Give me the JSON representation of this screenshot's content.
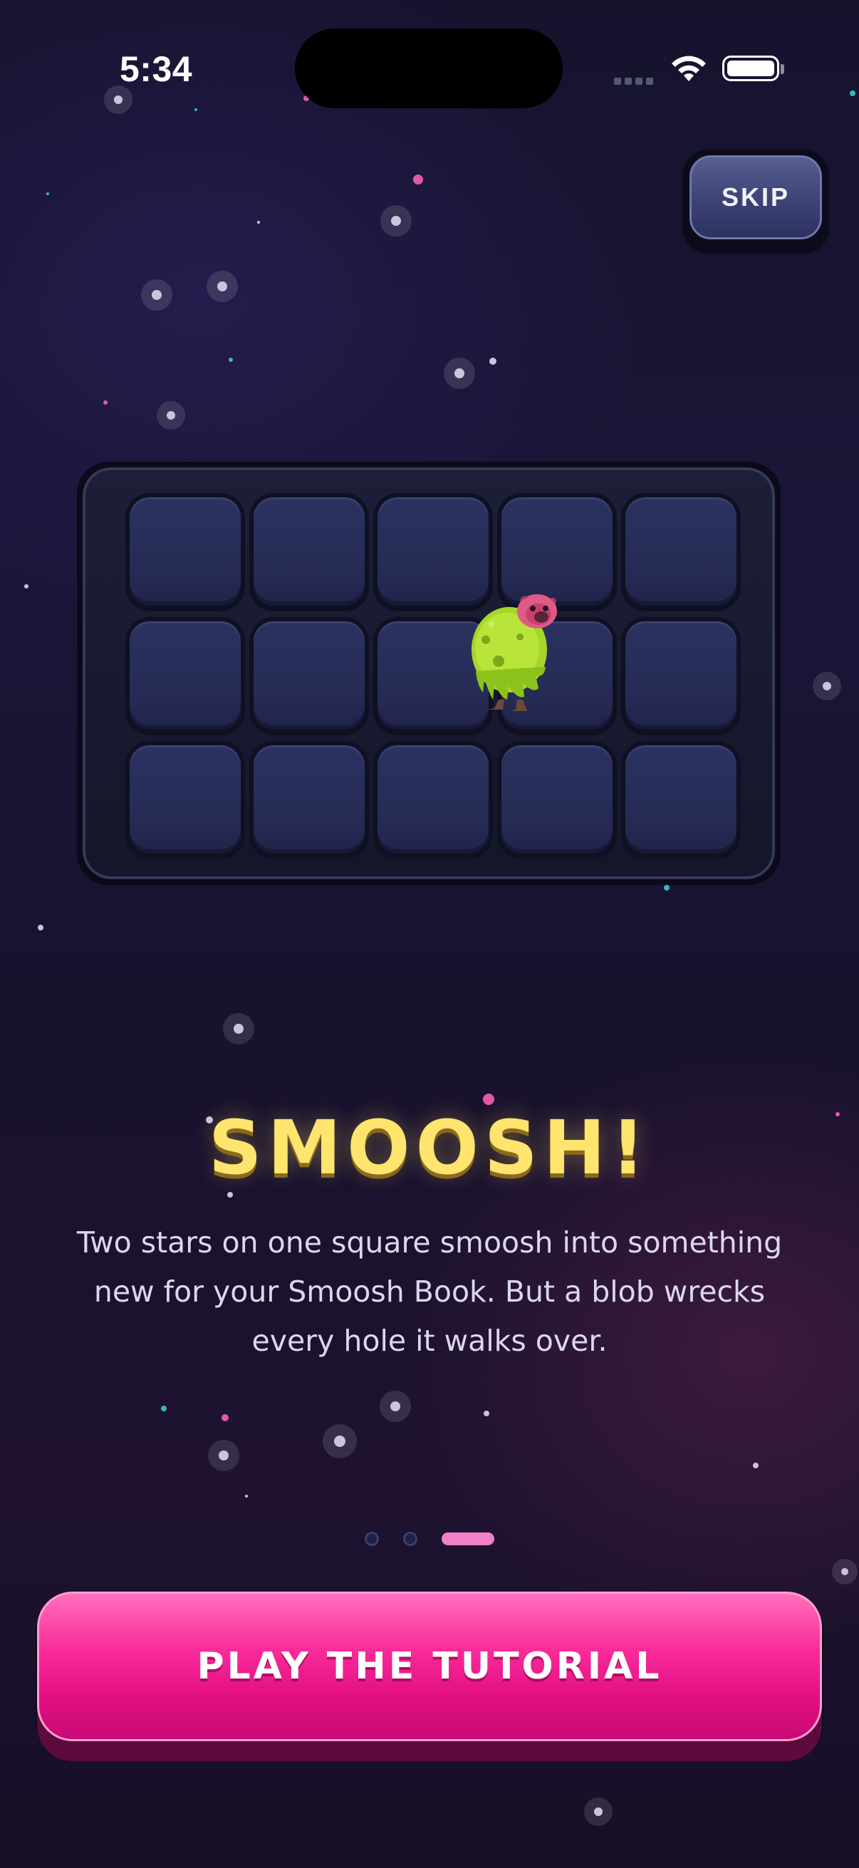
{
  "status_bar": {
    "time": "5:34",
    "wifi_icon": "wifi-icon",
    "battery_icon": "battery-full-icon",
    "signal_icon": "cellular-signal-icon"
  },
  "skip": {
    "label": "SKIP"
  },
  "board": {
    "rows": 3,
    "columns": 5,
    "creature": "green-slime-blob-with-pink-pug-face"
  },
  "content": {
    "title": "SMOOSH!",
    "description": "Two stars on one square smoosh into something new for your Smoosh Book. But a blob wrecks every hole it walks over."
  },
  "pagination": {
    "total": 3,
    "current": 3
  },
  "cta": {
    "label": "PLAY THE TUTORIAL"
  },
  "colors": {
    "title": "#ffe46e",
    "cta": "#f92a98",
    "active_dot": "#f280c8"
  }
}
